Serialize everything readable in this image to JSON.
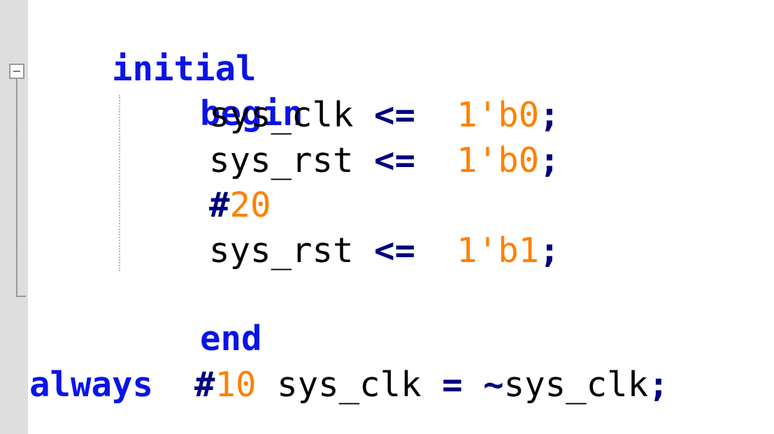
{
  "code": {
    "line1": {
      "keyword": "initial"
    },
    "line2": {
      "keyword": "begin"
    },
    "line3": {
      "ident": "sys_clk",
      "op": "<=",
      "value": "1'b0",
      "semi": ";"
    },
    "line4": {
      "ident": "sys_rst",
      "op": "<=",
      "value": "1'b0",
      "semi": ";"
    },
    "line5": {
      "hash": "#",
      "delay": "20"
    },
    "line6": {
      "ident": "sys_rst",
      "op": "<=",
      "value": "1'b1",
      "semi": ";"
    },
    "line7": {
      "keyword": "end"
    },
    "line9": {
      "keyword": "always",
      "hash": "#",
      "delay": "10",
      "ident": "sys_clk",
      "op": "=",
      "tilde": "~",
      "ident2": "sys_clk",
      "semi": ";"
    }
  },
  "colors": {
    "keyword": "#0a14e6",
    "operator": "#000080",
    "number": "#ff8000",
    "identifier": "#000000"
  },
  "icons": {
    "fold": "fold-collapse-icon"
  }
}
